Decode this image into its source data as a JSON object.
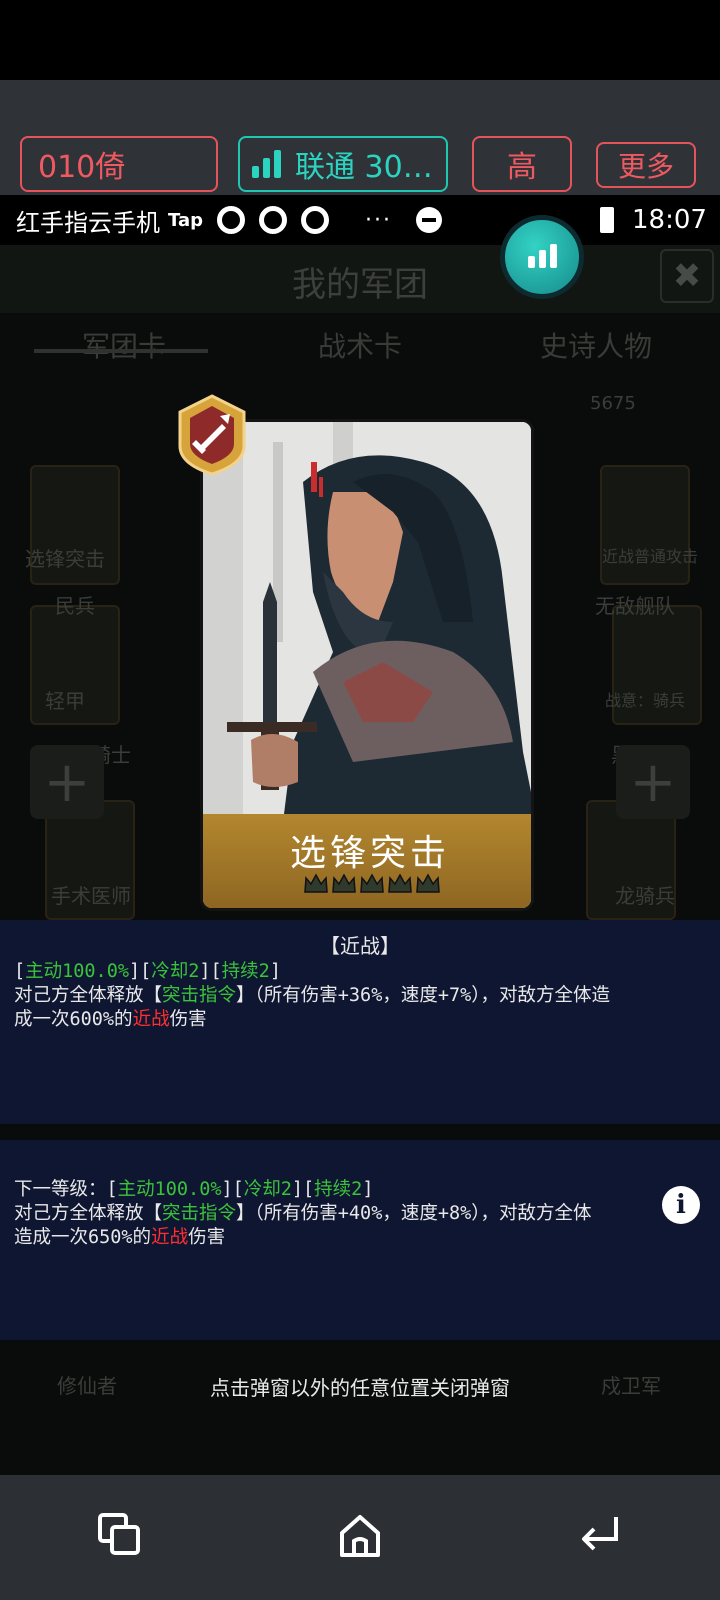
{
  "toolbar": {
    "device": "010倚",
    "network": "联通 30…",
    "quality": "高",
    "more": "更多",
    "colors": {
      "toolbar_bg": "#2f3338",
      "red": "#e4545b",
      "teal": "#1fc7b3"
    }
  },
  "status_bar": {
    "app_name": "红手指云手机",
    "tap_label": "Tap",
    "dots": "···",
    "time": "18:07"
  },
  "game": {
    "title": "我的军团",
    "close_icon": "✖",
    "tabs": [
      "军团卡",
      "战术卡",
      "史诗人物"
    ],
    "coins": "5675",
    "left_tags": [
      "选锋突击",
      "轻甲"
    ],
    "left_units": [
      "民兵",
      "骑马骑士",
      "手术医师",
      "修仙者"
    ],
    "right_tags": [
      "近战普通攻击",
      "战意：骑兵"
    ],
    "right_units": [
      "无敌舰队",
      "黑荒卫",
      "龙骑兵",
      "戍卫军"
    ]
  },
  "card": {
    "name": "选锋突击",
    "crown_count": 5,
    "badge_icon": "sword-icon"
  },
  "current_level": {
    "category": "【近战】",
    "tags": {
      "open": "[",
      "sep": "][",
      "close": "]",
      "active": "主动100.0%",
      "cooldown": "冷却2",
      "duration": "持续2"
    },
    "line2_a": "对己方全体释放【",
    "skill": "突击指令",
    "line2_b": "】（所有伤害+36%，速度+7%），对敌方全体造",
    "line3_a": "成一次600%的",
    "damage_type": "近战",
    "line3_b": "伤害"
  },
  "next_level": {
    "prefix": "下一等级：[",
    "active": "主动100.0%",
    "cooldown": "冷却2",
    "duration": "持续2",
    "sep": "][",
    "close": "]",
    "line2_a": "对己方全体释放【",
    "skill": "突击指令",
    "line2_b": "】（所有伤害+40%，速度+8%），对敌方全体",
    "line3_a": "造成一次650%的",
    "damage_type": "近战",
    "line3_b": "伤害",
    "info_icon": "i"
  },
  "hint": "点击弹窗以外的任意位置关闭弹窗",
  "nav": {
    "icons": [
      "recent-apps-icon",
      "home-icon",
      "back-icon"
    ]
  }
}
